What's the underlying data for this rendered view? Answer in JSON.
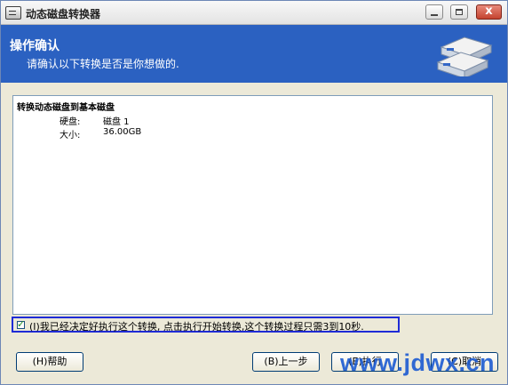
{
  "window": {
    "title": "动态磁盘转换器",
    "close_symbol": "x"
  },
  "banner": {
    "title": "操作确认",
    "subtitle": "请确认以下转换是否是你想做的."
  },
  "summary": {
    "heading": "转换动态磁盘到基本磁盘",
    "fields": [
      {
        "label": "硬盘:",
        "value": "磁盘 1"
      },
      {
        "label": "大小:",
        "value": "36.00GB"
      }
    ]
  },
  "confirmation": {
    "text": "(I)我已经决定好执行这个转换, 点击执行开始转换,这个转换过程只需3到10秒."
  },
  "buttons": {
    "help": "(H)帮助",
    "back": "(B)上一步",
    "execute": "(E)执行",
    "cancel": "(C)取消"
  },
  "watermark": "www.jdwx.cn",
  "colors": {
    "banner": "#2b61c1",
    "checkbox_border": "#1f2bd6"
  }
}
